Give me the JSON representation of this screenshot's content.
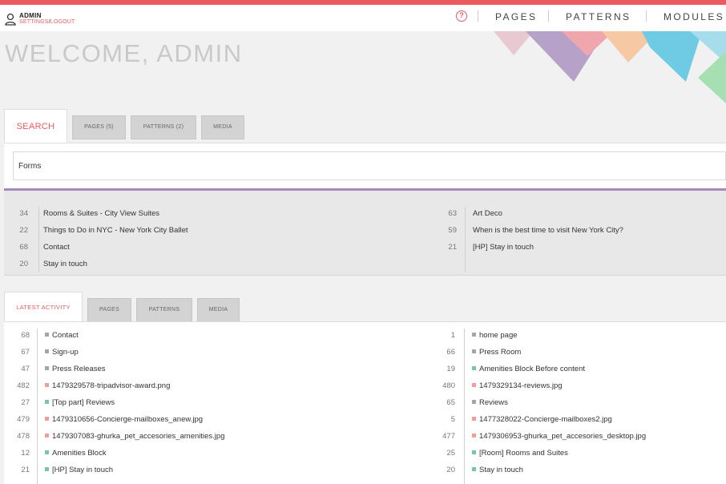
{
  "header": {
    "admin_name": "ADMIN",
    "settings_link": "SETTINGS",
    "separator": "/",
    "logout_link": "LOGOUT",
    "help_glyph": "?",
    "nav": [
      "PAGES",
      "PATTERNS",
      "MODULES"
    ]
  },
  "welcome": "WELCOME, ADMIN",
  "search_tabs": [
    "SEARCH",
    "PAGES (5)",
    "PATTERNS (2)",
    "MEDIA"
  ],
  "search": {
    "value": "Forms"
  },
  "results_left": [
    {
      "num": "34",
      "label": "Rooms & Suites - City View Suites"
    },
    {
      "num": "22",
      "label": "Things to Do in NYC - New York City Ballet"
    },
    {
      "num": "68",
      "label": "Contact"
    },
    {
      "num": "20",
      "label": "Stay in touch"
    }
  ],
  "results_right": [
    {
      "num": "63",
      "label": "Art Deco"
    },
    {
      "num": "59",
      "label": "When is the best time to visit New York City?"
    },
    {
      "num": "21",
      "label": "[HP] Stay in touch"
    }
  ],
  "activity_tabs": [
    "LATEST ACTIVITY",
    "PAGES",
    "PATTERNS",
    "MEDIA"
  ],
  "activity_left": [
    {
      "num": "68",
      "label": "Contact",
      "type": "gray"
    },
    {
      "num": "67",
      "label": "Sign-up",
      "type": "gray"
    },
    {
      "num": "47",
      "label": "Press Releases",
      "type": "gray"
    },
    {
      "num": "482",
      "label": "1479329578-tripadvisor-award.png",
      "type": "pink"
    },
    {
      "num": "27",
      "label": "[Top part] Reviews",
      "type": "green"
    },
    {
      "num": "479",
      "label": "1479310656-Concierge-mailboxes_anew.jpg",
      "type": "pink"
    },
    {
      "num": "478",
      "label": "1479307083-ghurka_pet_accesories_amenities.jpg",
      "type": "pink"
    },
    {
      "num": "12",
      "label": "Amenities Block",
      "type": "green"
    },
    {
      "num": "21",
      "label": "[HP] Stay in touch",
      "type": "green"
    }
  ],
  "activity_right": [
    {
      "num": "1",
      "label": "home page",
      "type": "gray"
    },
    {
      "num": "66",
      "label": "Press Room",
      "type": "gray"
    },
    {
      "num": "19",
      "label": "Amenities Block Before content",
      "type": "green"
    },
    {
      "num": "480",
      "label": "1479329134-reviews.jpg",
      "type": "pink"
    },
    {
      "num": "65",
      "label": "Reviews",
      "type": "gray"
    },
    {
      "num": "5",
      "label": "1477328022-Concierge-mailboxes2.jpg",
      "type": "pink"
    },
    {
      "num": "477",
      "label": "1479306953-ghurka_pet_accesories_desktop.jpg",
      "type": "pink"
    },
    {
      "num": "25",
      "label": "[Room] Rooms and Suites",
      "type": "green"
    },
    {
      "num": "20",
      "label": "Stay in touch",
      "type": "green"
    }
  ],
  "colors": {
    "accent": "#ea5a60",
    "divider": "#a58bb8",
    "page_marker": "#a6a6a6",
    "media_marker": "#f29c9c",
    "pattern_marker": "#76c7a2"
  },
  "icons": [
    "user-icon",
    "help-icon"
  ]
}
